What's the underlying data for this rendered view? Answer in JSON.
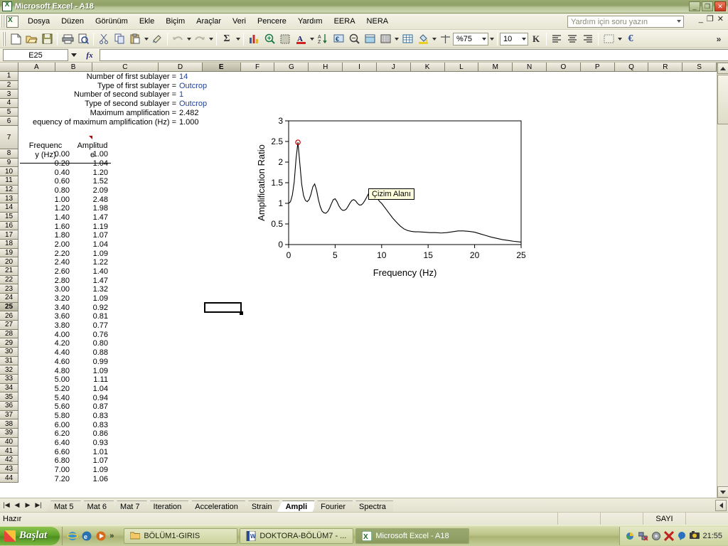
{
  "window": {
    "title": "Microsoft Excel - A18",
    "minimize": "_",
    "restore": "❐",
    "close": "✕"
  },
  "menu": {
    "items": [
      "Dosya",
      "Düzen",
      "Görünüm",
      "Ekle",
      "Biçim",
      "Araçlar",
      "Veri",
      "Pencere",
      "Yardım",
      "EERA",
      "NERA"
    ],
    "help_placeholder": "Yardım için soru yazın",
    "win_minimize": "_",
    "win_restore": "❐",
    "win_close": "✕"
  },
  "toolbar": {
    "zoom_value": "%75",
    "font_size_value": "10",
    "bold_label": "K",
    "icons": [
      "new-icon",
      "open-icon",
      "save-icon",
      "print-icon",
      "print-preview-icon",
      "cut-icon",
      "copy-icon",
      "paste-icon",
      "format-painter-icon",
      "undo-icon",
      "redo-icon",
      "autosum-icon",
      "chart-wizard-icon",
      "zoom-in-icon",
      "drawing-icon",
      "font-color-icon",
      "sort-asc-icon",
      "euro-format-icon",
      "zoom-out-icon",
      "borders-icon",
      "pattern-icon",
      "table-icon",
      "fill-color-icon",
      "merge-icon",
      "align-left-icon",
      "align-center-icon",
      "align-right-icon",
      "borders2-icon",
      "currency-icon",
      "overflow-icon"
    ]
  },
  "formula_bar": {
    "name_box": "E25",
    "fx_label": "fx",
    "formula_value": ""
  },
  "grid": {
    "columns": [
      "A",
      "B",
      "C",
      "D",
      "E",
      "F",
      "G",
      "H",
      "I",
      "J",
      "K",
      "L",
      "M",
      "N",
      "O",
      "P",
      "Q",
      "R",
      "S"
    ],
    "selected_column": "E",
    "selected_cell": "E25",
    "selected_row": 25,
    "rows": [
      1,
      2,
      3,
      4,
      5,
      6,
      7,
      8,
      9,
      10,
      11,
      12,
      13,
      14,
      15,
      16,
      17,
      18,
      19,
      20,
      21,
      22,
      23,
      24,
      25,
      26,
      27,
      28,
      29,
      30,
      31,
      32,
      33,
      34,
      35,
      36,
      37,
      38,
      39,
      40,
      41,
      42,
      43,
      44
    ],
    "summary": [
      {
        "label": "Number of first sublayer =",
        "value": "14",
        "style": "blue"
      },
      {
        "label": "Type of first sublayer =",
        "value": "Outcrop",
        "style": "blue"
      },
      {
        "label": "Number of second sublayer =",
        "value": "1",
        "style": "blue"
      },
      {
        "label": "Type of second sublayer =",
        "value": "Outcrop",
        "style": "blue"
      },
      {
        "label": "Maximum amplification =",
        "value": "2.482",
        "style": "black"
      },
      {
        "label": "equency of maximum amplification (Hz) =",
        "value": "1.000",
        "style": "black"
      }
    ],
    "table_headers": [
      "Frequenc",
      "y (Hz)",
      "Amplitud",
      "e"
    ],
    "table": [
      {
        "row": 8,
        "freq": "0.00",
        "amp": "1.00"
      },
      {
        "row": 9,
        "freq": "0.20",
        "amp": "1.04"
      },
      {
        "row": 10,
        "freq": "0.40",
        "amp": "1.20"
      },
      {
        "row": 11,
        "freq": "0.60",
        "amp": "1.52"
      },
      {
        "row": 12,
        "freq": "0.80",
        "amp": "2.09"
      },
      {
        "row": 13,
        "freq": "1.00",
        "amp": "2.48"
      },
      {
        "row": 14,
        "freq": "1.20",
        "amp": "1.98"
      },
      {
        "row": 15,
        "freq": "1.40",
        "amp": "1.47"
      },
      {
        "row": 16,
        "freq": "1.60",
        "amp": "1.19"
      },
      {
        "row": 17,
        "freq": "1.80",
        "amp": "1.07"
      },
      {
        "row": 18,
        "freq": "2.00",
        "amp": "1.04"
      },
      {
        "row": 19,
        "freq": "2.20",
        "amp": "1.09"
      },
      {
        "row": 20,
        "freq": "2.40",
        "amp": "1.22"
      },
      {
        "row": 21,
        "freq": "2.60",
        "amp": "1.40"
      },
      {
        "row": 22,
        "freq": "2.80",
        "amp": "1.47"
      },
      {
        "row": 23,
        "freq": "3.00",
        "amp": "1.32"
      },
      {
        "row": 24,
        "freq": "3.20",
        "amp": "1.09"
      },
      {
        "row": 25,
        "freq": "3.40",
        "amp": "0.92"
      },
      {
        "row": 26,
        "freq": "3.60",
        "amp": "0.81"
      },
      {
        "row": 27,
        "freq": "3.80",
        "amp": "0.77"
      },
      {
        "row": 28,
        "freq": "4.00",
        "amp": "0.76"
      },
      {
        "row": 29,
        "freq": "4.20",
        "amp": "0.80"
      },
      {
        "row": 30,
        "freq": "4.40",
        "amp": "0.88"
      },
      {
        "row": 31,
        "freq": "4.60",
        "amp": "0.99"
      },
      {
        "row": 32,
        "freq": "4.80",
        "amp": "1.09"
      },
      {
        "row": 33,
        "freq": "5.00",
        "amp": "1.11"
      },
      {
        "row": 34,
        "freq": "5.20",
        "amp": "1.04"
      },
      {
        "row": 35,
        "freq": "5.40",
        "amp": "0.94"
      },
      {
        "row": 36,
        "freq": "5.60",
        "amp": "0.87"
      },
      {
        "row": 37,
        "freq": "5.80",
        "amp": "0.83"
      },
      {
        "row": 38,
        "freq": "6.00",
        "amp": "0.83"
      },
      {
        "row": 39,
        "freq": "6.20",
        "amp": "0.86"
      },
      {
        "row": 40,
        "freq": "6.40",
        "amp": "0.93"
      },
      {
        "row": 41,
        "freq": "6.60",
        "amp": "1.01"
      },
      {
        "row": 42,
        "freq": "6.80",
        "amp": "1.07"
      },
      {
        "row": 43,
        "freq": "7.00",
        "amp": "1.09"
      },
      {
        "row": 44,
        "freq": "7.20",
        "amp": "1.06"
      }
    ]
  },
  "chart_data": {
    "type": "line",
    "title": "",
    "xlabel": "Frequency (Hz)",
    "ylabel": "Amplification Ratio",
    "xlim": [
      0,
      25
    ],
    "ylim": [
      0,
      3
    ],
    "xticks": [
      0,
      5,
      10,
      15,
      20,
      25
    ],
    "yticks": [
      0,
      0.5,
      1,
      1.5,
      2,
      2.5,
      3
    ],
    "grid": false,
    "legend": "none",
    "line_color": "#000000",
    "marker": {
      "x": 1.0,
      "y": 2.48,
      "color": "#cc0000",
      "shape": "circle",
      "label": "maximum amplification"
    },
    "tooltip": "Çizim Alanı",
    "x": [
      0.0,
      0.2,
      0.4,
      0.6,
      0.8,
      1.0,
      1.2,
      1.4,
      1.6,
      1.8,
      2.0,
      2.2,
      2.4,
      2.6,
      2.8,
      3.0,
      3.2,
      3.4,
      3.6,
      3.8,
      4.0,
      4.2,
      4.4,
      4.6,
      4.8,
      5.0,
      5.2,
      5.4,
      5.6,
      5.8,
      6.0,
      6.2,
      6.4,
      6.6,
      6.8,
      7.0,
      7.2,
      7.4,
      7.6,
      7.8,
      8.0,
      8.2,
      8.4,
      8.6,
      8.8,
      9.0,
      9.2,
      9.4,
      9.6,
      9.8,
      10.0,
      10.4,
      10.8,
      11.2,
      11.6,
      12.0,
      12.4,
      12.8,
      13.2,
      13.6,
      14.0,
      14.6,
      15.2,
      15.8,
      16.4,
      17.0,
      17.6,
      18.2,
      18.8,
      19.4,
      20.0,
      20.6,
      21.2,
      21.8,
      22.4,
      23.0,
      23.6,
      24.2,
      24.6,
      25.0
    ],
    "y": [
      1.0,
      1.04,
      1.2,
      1.52,
      2.09,
      2.48,
      1.98,
      1.47,
      1.19,
      1.07,
      1.04,
      1.09,
      1.22,
      1.4,
      1.47,
      1.32,
      1.09,
      0.92,
      0.81,
      0.77,
      0.76,
      0.8,
      0.88,
      0.99,
      1.09,
      1.11,
      1.04,
      0.94,
      0.87,
      0.83,
      0.83,
      0.86,
      0.93,
      1.01,
      1.07,
      1.09,
      1.06,
      1.0,
      0.96,
      0.96,
      1.0,
      1.07,
      1.15,
      1.24,
      1.3,
      1.29,
      1.24,
      1.17,
      1.1,
      1.04,
      1.0,
      0.88,
      0.76,
      0.64,
      0.54,
      0.45,
      0.38,
      0.34,
      0.32,
      0.31,
      0.31,
      0.3,
      0.29,
      0.29,
      0.28,
      0.29,
      0.31,
      0.33,
      0.33,
      0.32,
      0.3,
      0.26,
      0.22,
      0.18,
      0.15,
      0.12,
      0.1,
      0.08,
      0.07,
      0.06
    ]
  },
  "sheet_tabs": {
    "nav": [
      "first-sheet",
      "prev-sheet",
      "next-sheet",
      "last-sheet"
    ],
    "tabs": [
      "Mat 5",
      "Mat 6",
      "Mat 7",
      "Iteration",
      "Acceleration",
      "Strain",
      "Ampli",
      "Fourier",
      "Spectra"
    ],
    "active": "Ampli"
  },
  "status_bar": {
    "left": "Hazır",
    "num_lock": "SAYI"
  },
  "taskbar": {
    "start": "Başlat",
    "quick_launch": [
      "internet-explorer-icon",
      "outlook-icon",
      "media-player-icon"
    ],
    "overflow": "»",
    "tasks": [
      {
        "label": "BÖLÜM1-GIRIS",
        "icon": "folder-icon",
        "active": false
      },
      {
        "label": "DOKTORA-BÖLÜM7 - ...",
        "icon": "word-icon",
        "active": false
      },
      {
        "label": "Microsoft Excel - A18",
        "icon": "excel-icon",
        "active": true
      }
    ],
    "tray_icons": [
      "volume-icon",
      "network-icon",
      "shield-icon",
      "antivirus-icon",
      "messenger-icon",
      "camera-icon"
    ],
    "clock": "21:55"
  }
}
